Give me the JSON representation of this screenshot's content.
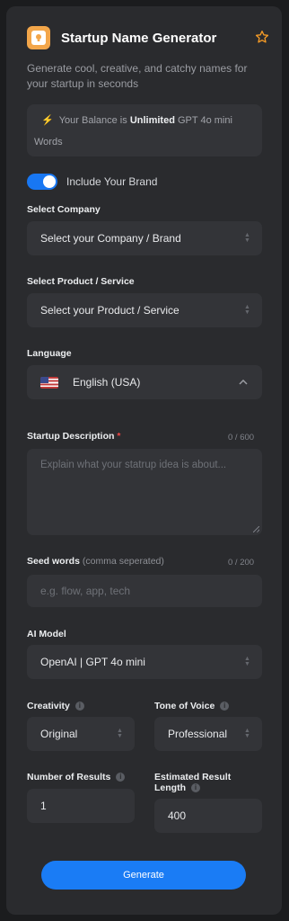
{
  "header": {
    "title": "Startup Name Generator",
    "subtitle": "Generate cool, creative, and catchy names for your startup in seconds"
  },
  "balance": {
    "prefix": "Your Balance is",
    "amount": "Unlimited",
    "model": "GPT 4o mini",
    "unit": "Words"
  },
  "brand_toggle": {
    "label": "Include Your Brand",
    "on": true
  },
  "company": {
    "label": "Select Company",
    "value": "Select your Company / Brand"
  },
  "product": {
    "label": "Select Product / Service",
    "value": "Select your Product / Service"
  },
  "language": {
    "label": "Language",
    "value": "English (USA)"
  },
  "description": {
    "label": "Startup Description",
    "required_mark": "*",
    "counter": "0 / 600",
    "placeholder": "Explain what your statrup idea is about..."
  },
  "seed": {
    "label": "Seed words",
    "hint": "(comma seperated)",
    "counter": "0 / 200",
    "placeholder": "e.g. flow, app, tech"
  },
  "ai_model": {
    "label": "AI Model",
    "value": "OpenAI | GPT 4o mini"
  },
  "creativity": {
    "label": "Creativity",
    "value": "Original"
  },
  "tone": {
    "label": "Tone of Voice",
    "value": "Professional"
  },
  "results": {
    "label": "Number of Results",
    "value": "1"
  },
  "length": {
    "label_line1": "Estimated Result",
    "label_line2": "Length",
    "value": "400"
  },
  "generate_button": "Generate",
  "colors": {
    "accent": "#1a7cf5",
    "star": "#f39a26",
    "required": "#ef4444"
  }
}
